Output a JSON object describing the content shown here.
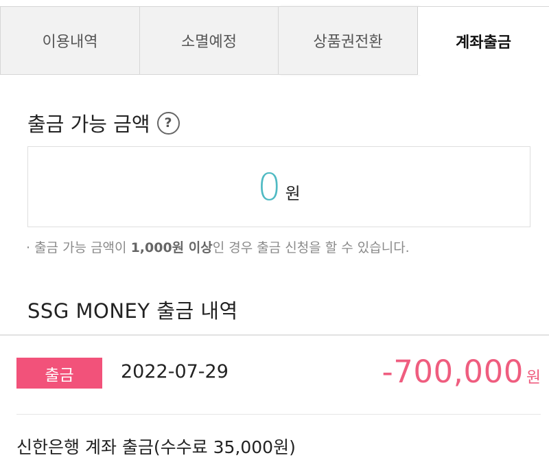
{
  "tabs": [
    {
      "label": "이용내역"
    },
    {
      "label": "소멸예정"
    },
    {
      "label": "상품권전환"
    },
    {
      "label": "계좌출금"
    }
  ],
  "available": {
    "title": "출금 가능 금액",
    "help_icon": "question-icon",
    "amount": "0",
    "unit": "원",
    "notice_pre": "· 출금 가능 금액이 ",
    "notice_bold": "1,000원 이상",
    "notice_post": "인 경우 출금 신청을 할 수 있습니다."
  },
  "history": {
    "title": "SSG MONEY 출금 내역",
    "items": [
      {
        "badge": "출금",
        "date": "2022-07-29",
        "amount": "-700,000",
        "unit": "원",
        "description": "신한은행 계좌 출금(수수료 35,000원)"
      }
    ]
  },
  "colors": {
    "accent_teal": "#4fbac3",
    "badge_pink": "#f2527a",
    "amount_pink": "#ef5d7f"
  }
}
